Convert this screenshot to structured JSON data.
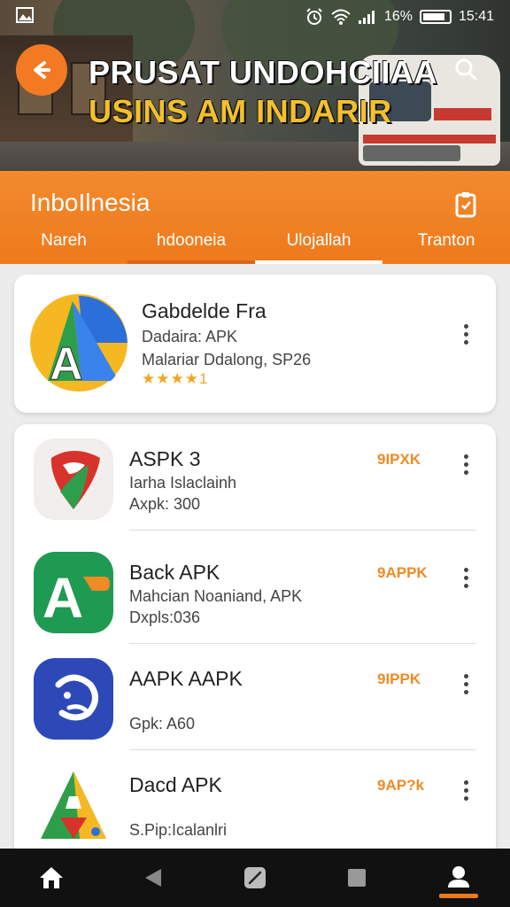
{
  "status_bar": {
    "battery": "16%",
    "time": "15:41",
    "icons": [
      "gallery-icon",
      "alarm-icon",
      "wifi-icon",
      "signal-icon",
      "battery-icon"
    ]
  },
  "header": {
    "title_line1": "PRUSAT UNDOHCIIAA",
    "title_line2": "USINS AM INDARIR",
    "back_icon": "back-arrow-icon",
    "search_icon": "search-icon"
  },
  "appbar": {
    "title": "InboIlnesia",
    "action_icon": "bookmark-icon"
  },
  "tabs": [
    {
      "label": "Nareh"
    },
    {
      "label": "hdooneia"
    },
    {
      "label": "Ulojallah"
    },
    {
      "label": "Tranton"
    }
  ],
  "featured": {
    "name": "Gabdelde Fra",
    "line1": "Dadaira: APK",
    "line2": "Malariar Ddalong, SP26",
    "stars": "★★★★",
    "rating": "1"
  },
  "apps": [
    {
      "name": "ASPK 3",
      "line1": "Iarha Islaclainh",
      "line2": "Axpk: 300",
      "badge": "9IPXK"
    },
    {
      "name": "Back APK",
      "line1": "Mahcian Noaniand, APK",
      "line2": "Dxpls:036",
      "badge": "9APPK"
    },
    {
      "name": "AAPK AAPK",
      "line1": "",
      "line2": "Gpk: A60",
      "badge": "9IPPK"
    },
    {
      "name": "Dacd APK",
      "line1": "",
      "line2": "S.Pip:Icalanlri",
      "badge": "9AP?k"
    }
  ],
  "bottom_nav": [
    {
      "icon": "home-icon"
    },
    {
      "icon": "back-triangle-icon"
    },
    {
      "icon": "edit-icon"
    },
    {
      "icon": "square-icon"
    },
    {
      "icon": "profile-icon"
    }
  ],
  "colors": {
    "accent": "#ee7a1c",
    "badge": "#f08a24",
    "title_yellow": "#f3c02b"
  }
}
